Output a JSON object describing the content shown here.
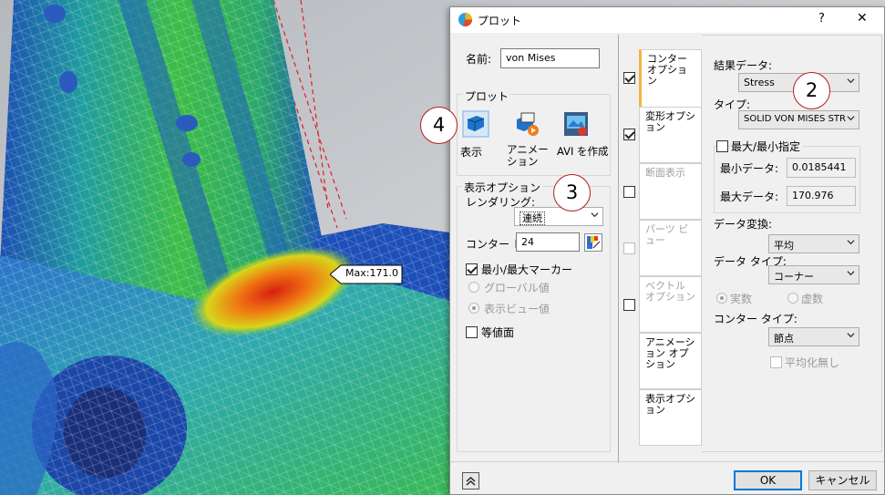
{
  "viewport": {
    "max_label": "Max:171.0"
  },
  "dialog": {
    "title": "プロット",
    "help": "?",
    "close": "✕",
    "name_label": "名前:",
    "name_value": "von Mises",
    "plot_group": "プロット",
    "plot_buttons": {
      "show": "表示",
      "animation": "アニメーション",
      "avi": "AVI を作成"
    },
    "display_group": "表示オプション",
    "rendering_label": "レンダリング:",
    "rendering_value": "連続",
    "contour_label": "コンター レ",
    "contour_value": "24",
    "minmax_marker": "最小/最大マーカー",
    "global_value": "グローバル値",
    "display_view_value": "表示ビュー値",
    "isosurface": "等値面",
    "tabs": [
      {
        "label": "コンター オプション",
        "checked": true
      },
      {
        "label": "変形オプション",
        "checked": true
      },
      {
        "label": "断面表示",
        "checked": false
      },
      {
        "label": "パーツ ビュー",
        "checked": false
      },
      {
        "label": "ベクトル オプション",
        "checked": false
      },
      {
        "label": "アニメーション オプション"
      },
      {
        "label": "表示オプション"
      }
    ],
    "result_data_label": "結果データ:",
    "result_data_value": "Stress",
    "type_label": "タイプ:",
    "type_value": "SOLID VON MISES STR",
    "minmax_specify": "最大/最小指定",
    "min_data_label": "最小データ:",
    "min_data_value": "0.0185441",
    "max_data_label": "最大データ:",
    "max_data_value": "170.976",
    "data_conversion_label": "データ変換:",
    "data_conversion_value": "平均",
    "data_type_label": "データ タイプ:",
    "data_type_value": "コーナー",
    "real_label": "実数",
    "imag_label": "虚数",
    "contour_type_label": "コンター タイプ:",
    "contour_type_value": "節点",
    "no_average": "平均化無し",
    "ok": "OK",
    "cancel": "キャンセル",
    "collapse_icon": "double-chevron-up-icon"
  },
  "callouts": {
    "c2": "2",
    "c3": "3",
    "c4": "4"
  },
  "colors": {
    "accent": "#0078d7",
    "tab_highlight": "#f3b341",
    "callout_border": "#b21e1e"
  }
}
